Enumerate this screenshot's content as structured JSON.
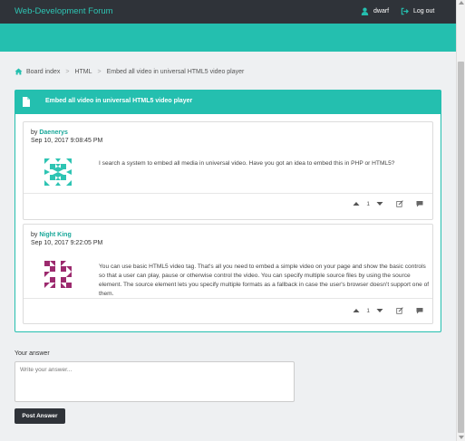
{
  "navbar": {
    "brand": "Web-Development Forum",
    "user_label": "dwarf",
    "logout_label": "Log out"
  },
  "breadcrumb": {
    "items": [
      "Board index",
      "HTML",
      "Embed all video in universal HTML5 video player"
    ]
  },
  "topic": {
    "title": "Embed all video in universal HTML5 video player",
    "posts": [
      {
        "by_prefix": "by",
        "author": "Daenerys",
        "date": "Sep 10, 2017 9:08:45 PM",
        "body": "I search a system to embed all media in universal video. Have you got an idea to embed this in PHP or HTML5?",
        "votes": "1"
      },
      {
        "by_prefix": "by",
        "author": "Night King",
        "date": "Sep 10, 2017 9:22:05 PM",
        "body": "You can use basic HTML5 video tag. That's all you need to embed a simple video on your page and show the basic controls so that a user can play, pause or otherwise control the video. You can specify multiple source files by using the source element. The source element lets you specify multiple formats as a fallback in case the user's browser doesn't support one of them.",
        "votes": "1"
      }
    ]
  },
  "answer_form": {
    "label": "Your answer",
    "placeholder": "Write your answer...",
    "submit_label": "Post Answer"
  },
  "colors": {
    "accent": "#24bfaf",
    "navbar": "#2f3339",
    "avatar1": "#2ec4b3",
    "avatar2": "#9c2a6e"
  }
}
